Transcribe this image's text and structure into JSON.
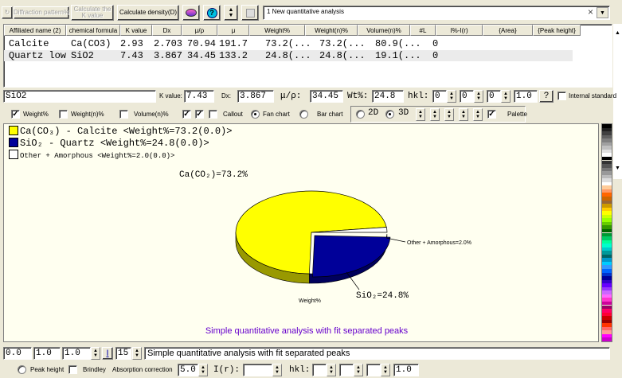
{
  "toolbar": {
    "diffraction_pattern_label": "Diffraction pattern%",
    "calculate_k_label": "Calculate the K value",
    "calculate_density_label": "Calculate density(D)",
    "analysis_name": "1 New quantitative analysis"
  },
  "table": {
    "columns": [
      "Affiliated name  (2)",
      "chemical formula",
      "K value",
      "Dx",
      "μ/ρ",
      "μ",
      "Weight%",
      "Weight(n)%",
      "Volume(n)%",
      "#L",
      "I%-I(r)",
      "{Area}",
      "{Peak height}"
    ],
    "rows": [
      {
        "name": "Calcite",
        "formula": "Ca(CO3)",
        "k": "2.93",
        "dx": "2.703",
        "mu_rho": "70.94",
        "mu": "191.7",
        "weight": "73.2(...",
        "weight_n": "73.2(...",
        "volume_n": "80.9(...",
        "l": "0"
      },
      {
        "name": "Quartz low",
        "formula": "SiO2",
        "k": "7.43",
        "dx": "3.867",
        "mu_rho": "34.45",
        "mu": "133.2",
        "weight": "24.8(...",
        "weight_n": "24.8(...",
        "volume_n": "19.1(...",
        "l": "0"
      }
    ]
  },
  "editor": {
    "phase_formula": "SiO2",
    "k_label": "K value:",
    "k_value": "7.43",
    "dx_label": "Dx:",
    "dx_value": "3.867",
    "mu_rho_label": "μ/ρ:",
    "mu_rho_value": "34.45",
    "wt_label": "Wt%:",
    "wt_value": "24.8",
    "hkl_label": "hkl:",
    "h": "0",
    "k": "0",
    "l": "0",
    "scale": "1.0",
    "question": "?",
    "internal_standard_label": "Internal standard"
  },
  "options": {
    "weight_label": "Weight%",
    "weight_n_label": "Weight(n)%",
    "volume_label": "Volume(n)%",
    "callout_label": "Callout",
    "fan_chart_label": "Fan chart",
    "bar_chart_label": "Bar chart",
    "two_d_label": "2D",
    "three_d_label": "3D",
    "palette_label": "Palette"
  },
  "chart_data": {
    "type": "pie",
    "legend": [
      {
        "label": "Ca(CO₃) - Calcite",
        "value_text": "<Weight%=73.2(0.0)>",
        "color": "#ffff00"
      },
      {
        "label": "SiO₂ - Quartz",
        "value_text": "<Weight%=24.8(0.0)>",
        "color": "#000099"
      },
      {
        "label": "Other + Amorphous",
        "value_text": "<Weight%=2.0(0.0)>",
        "color": "#ffffff"
      }
    ],
    "slices": [
      {
        "name": "CaCO3",
        "value": 73.2,
        "color": "#ffff00",
        "label": "Ca(CO₂)=73.2%"
      },
      {
        "name": "SiO2",
        "value": 24.8,
        "color": "#000099",
        "label": "SiO₂=24.8%"
      },
      {
        "name": "Other + Amorphous",
        "value": 2.0,
        "color": "#ffffff",
        "label": "Other + Amorphous=2.0%"
      }
    ],
    "axis_label": "Weight%",
    "caption": "Simple quantitative analysis with fit separated peaks",
    "caption_color": "#6600cc",
    "background": "#fffff0"
  },
  "bottom": {
    "v1": "0.0",
    "v2": "1.0",
    "v3": "1.0",
    "i_label": "I",
    "font_size": "15",
    "caption_input": "Simple quantitative analysis with fit separated peaks",
    "peak_height_label": "Peak height",
    "brindley_label": "Brindley",
    "absorption_label": "Absorption correction",
    "absorption_value": "5.0",
    "ir_label": "I(r):",
    "hkl_label": "hkl:",
    "end_value": "1.0"
  },
  "palette_colors": [
    "#000000",
    "#202020",
    "#404040",
    "#606060",
    "#808080",
    "#a0a0a0",
    "#c0c0c0",
    "#e0e0e0",
    "#ffffff",
    "#000000",
    "#333333",
    "#555555",
    "#777777",
    "#999999",
    "#bbbbbb",
    "#dddddd",
    "#ffffff",
    "#ffcc99",
    "#ff9966",
    "#ff6600",
    "#cc6600",
    "#996633",
    "#cc9900",
    "#ffcc00",
    "#ffff00",
    "#ccff00",
    "#99ff00",
    "#66cc00",
    "#339900",
    "#006600",
    "#009933",
    "#00cc66",
    "#00ff99",
    "#00ffcc",
    "#00cccc",
    "#009999",
    "#006666",
    "#0099cc",
    "#00ccff",
    "#3399ff",
    "#0066ff",
    "#0033cc",
    "#000099",
    "#3300cc",
    "#6600ff",
    "#9933ff",
    "#cc66ff",
    "#ff66ff",
    "#ff33cc",
    "#cc0099",
    "#990066",
    "#ff0066",
    "#ff0033",
    "#cc0000",
    "#990000",
    "#ff3300",
    "#ff6666",
    "#ff9999",
    "#ff00ff",
    "#cc00cc"
  ]
}
